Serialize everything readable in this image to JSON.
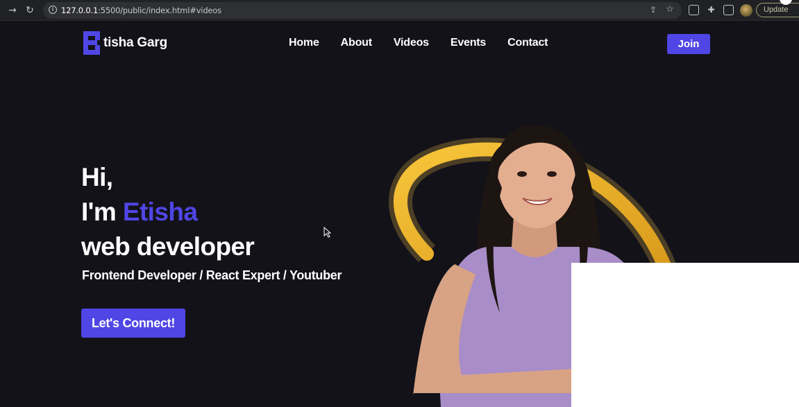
{
  "browser": {
    "url_host": "127.0.0.1",
    "url_rest": ":5500/public/index.html#videos",
    "update_label": "Update",
    "icons": [
      "back-arrow-icon",
      "reload-icon",
      "info-icon",
      "share-icon",
      "star-icon",
      "extension-icon",
      "puzzle-icon",
      "side-panel-icon",
      "profile-avatar",
      "kebab-menu-icon"
    ]
  },
  "site": {
    "brand": {
      "mark": "E",
      "name": "tisha Garg"
    },
    "nav": [
      "Home",
      "About",
      "Videos",
      "Events",
      "Contact"
    ],
    "join_label": "Join",
    "hero": {
      "greeting": "Hi,",
      "intro_prefix": "I'm ",
      "intro_name": "Etisha",
      "role": "web developer",
      "subtitle": "Frontend Developer / React Expert / Youtuber",
      "cta_label": "Let's Connect!"
    },
    "colors": {
      "accent": "#4f46e5",
      "background": "#131219",
      "text": "#ffffff",
      "ring": "#f0b72a",
      "shirt": "#a98dc8"
    }
  }
}
